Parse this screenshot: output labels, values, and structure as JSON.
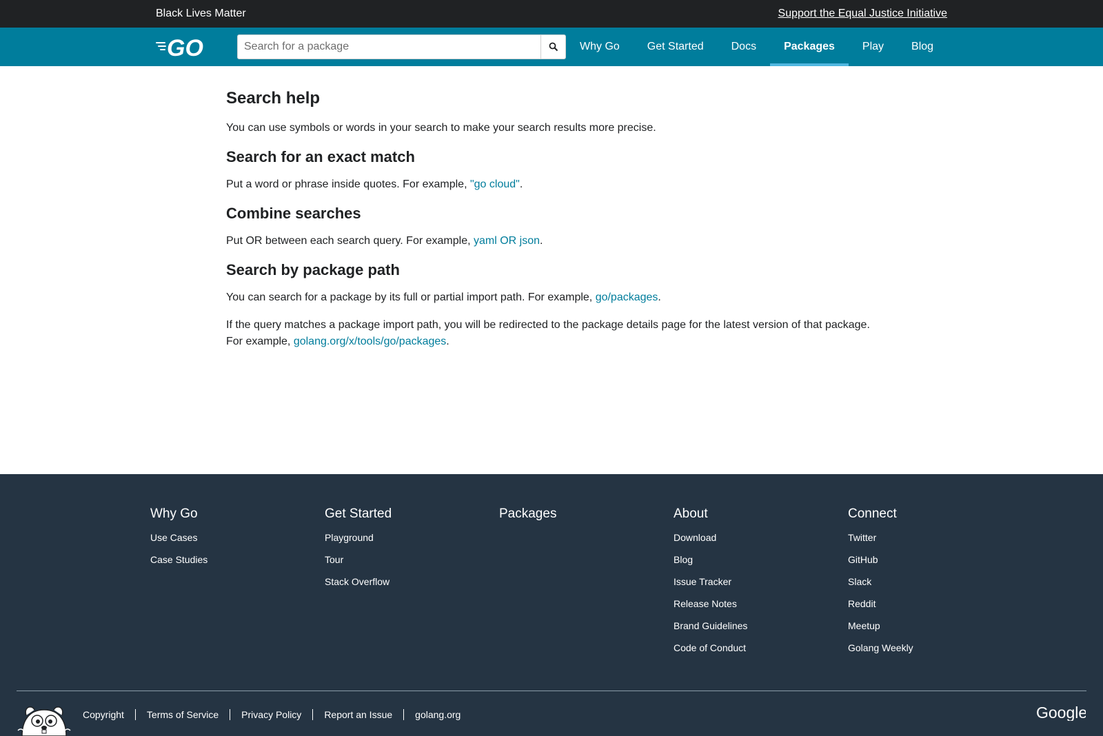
{
  "banner": {
    "left_text": "Black Lives Matter",
    "right_link": "Support the Equal Justice Initiative"
  },
  "header": {
    "logo": "GO",
    "search": {
      "placeholder": "Search for a package",
      "value": ""
    },
    "nav": [
      {
        "label": "Why Go",
        "active": false
      },
      {
        "label": "Get Started",
        "active": false
      },
      {
        "label": "Docs",
        "active": false
      },
      {
        "label": "Packages",
        "active": true
      },
      {
        "label": "Play",
        "active": false
      },
      {
        "label": "Blog",
        "active": false
      }
    ]
  },
  "main": {
    "title": "Search help",
    "intro": "You can use symbols or words in your search to make your search results more precise.",
    "exact": {
      "heading": "Search for an exact match",
      "text": "Put a word or phrase inside quotes. For example, ",
      "link": "\"go cloud\"",
      "end": "."
    },
    "combine": {
      "heading": "Combine searches",
      "text": "Put OR between each search query. For example, ",
      "link": "yaml OR json",
      "end": "."
    },
    "path": {
      "heading": "Search by package path",
      "text1": "You can search for a package by its full or partial import path. For example, ",
      "link1": "go/packages",
      "end1": ".",
      "text2": "If the query matches a package import path, you will be redirected to the package details page for the latest version of that package.",
      "text3": "For example, ",
      "link2": "golang.org/x/tools/go/packages",
      "end2": "."
    }
  },
  "footer": {
    "columns": [
      {
        "title": "Why Go",
        "links": [
          "Use Cases",
          "Case Studies"
        ]
      },
      {
        "title": "Get Started",
        "links": [
          "Playground",
          "Tour",
          "Stack Overflow"
        ]
      },
      {
        "title": "Packages",
        "links": []
      },
      {
        "title": "About",
        "links": [
          "Download",
          "Blog",
          "Issue Tracker",
          "Release Notes",
          "Brand Guidelines",
          "Code of Conduct"
        ]
      },
      {
        "title": "Connect",
        "links": [
          "Twitter",
          "GitHub",
          "Slack",
          "Reddit",
          "Meetup",
          "Golang Weekly"
        ]
      }
    ],
    "legal": [
      "Copyright",
      "Terms of Service",
      "Privacy Policy",
      "Report an Issue",
      "golang.org"
    ],
    "google_logo": "Google"
  },
  "colors": {
    "header_bg": "#007d9c",
    "banner_bg": "#202224",
    "footer_bg": "#253443",
    "link": "#007d9c",
    "active_underline": "#50b7e0"
  }
}
